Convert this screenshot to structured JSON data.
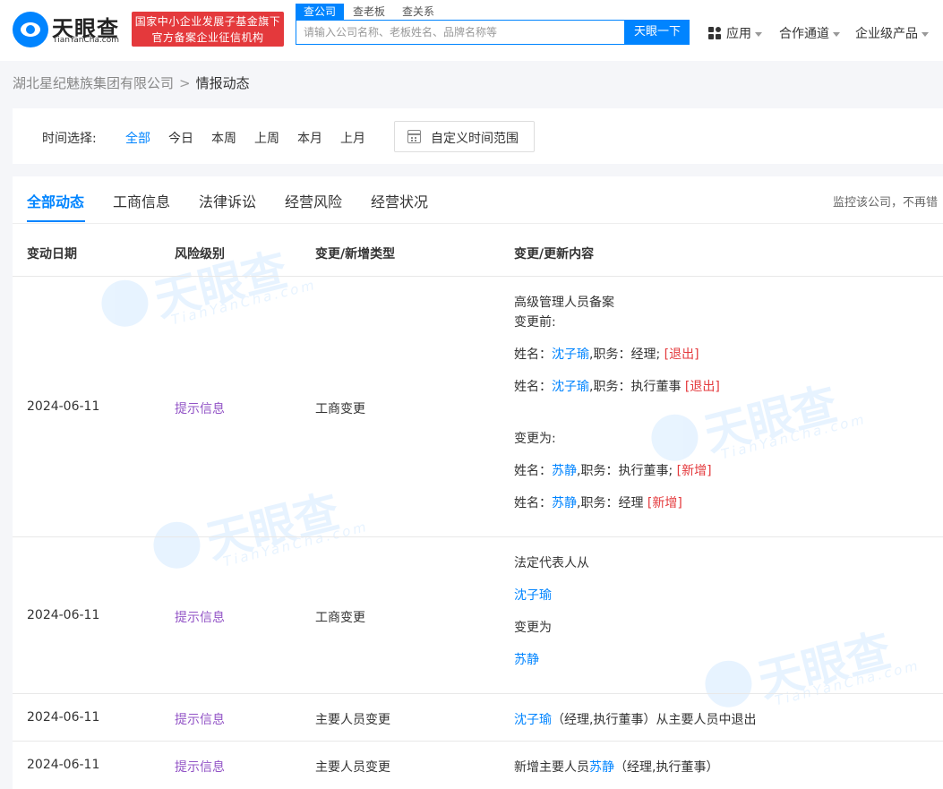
{
  "header": {
    "logo_cn": "天眼查",
    "logo_en": "TianYanCha.com",
    "banner_line1": "国家中小企业发展子基金旗下",
    "banner_line2": "官方备案企业征信机构",
    "search_tabs": [
      "查公司",
      "查老板",
      "查关系"
    ],
    "search_placeholder": "请输入公司名称、老板姓名、品牌名称等",
    "search_button": "天眼一下",
    "nav": [
      "应用",
      "合作通道",
      "企业级产品"
    ]
  },
  "breadcrumb": {
    "company": "湖北星纪魅族集团有限公司",
    "separator": ">",
    "current": "情报动态"
  },
  "time_filter": {
    "label": "时间选择:",
    "options": [
      "全部",
      "今日",
      "本周",
      "上周",
      "本月",
      "上月"
    ],
    "active": "全部",
    "custom": "自定义时间范围"
  },
  "tabs": [
    "全部动态",
    "工商信息",
    "法律诉讼",
    "经营风险",
    "经营状况"
  ],
  "active_tab": "全部动态",
  "monitor_text": "监控该公司，不再错",
  "columns": [
    "变动日期",
    "风险级别",
    "变更/新增类型",
    "变更/更新内容"
  ],
  "rows": [
    {
      "date": "2024-06-11",
      "risk": "提示信息",
      "type": "工商变更",
      "title": "高级管理人员备案",
      "before_label": "变更前:",
      "before": [
        {
          "prefix": "姓名：",
          "name": "沈子瑜",
          "role": ",职务：经理;",
          "tag": "[退出]"
        },
        {
          "prefix": "姓名：",
          "name": "沈子瑜",
          "role": ",职务：执行董事",
          "tag": "[退出]"
        }
      ],
      "after_label": "变更为:",
      "after": [
        {
          "prefix": "姓名：",
          "name": "苏静",
          "role": ",职务：执行董事;",
          "tag": "[新增]"
        },
        {
          "prefix": "姓名：",
          "name": "苏静",
          "role": ",职务：经理",
          "tag": "[新增]"
        }
      ]
    },
    {
      "date": "2024-06-11",
      "risk": "提示信息",
      "type": "工商变更",
      "line1": "法定代表人从",
      "from_name": "沈子瑜",
      "line2": "变更为",
      "to_name": "苏静"
    },
    {
      "date": "2024-06-11",
      "risk": "提示信息",
      "type": "主要人员变更",
      "name": "沈子瑜",
      "text": "（经理,执行董事）从主要人员中退出"
    },
    {
      "date": "2024-06-11",
      "risk": "提示信息",
      "type": "主要人员变更",
      "prefix": "新增主要人员",
      "name": "苏静",
      "text": "（经理,执行董事）"
    }
  ],
  "watermark": {
    "cn": "天眼查",
    "en": "TianYanCha.com"
  },
  "colors": {
    "accent": "#0084ff",
    "risk": "#9253c6",
    "tag": "#e4393c",
    "banner": "#e4393c"
  }
}
